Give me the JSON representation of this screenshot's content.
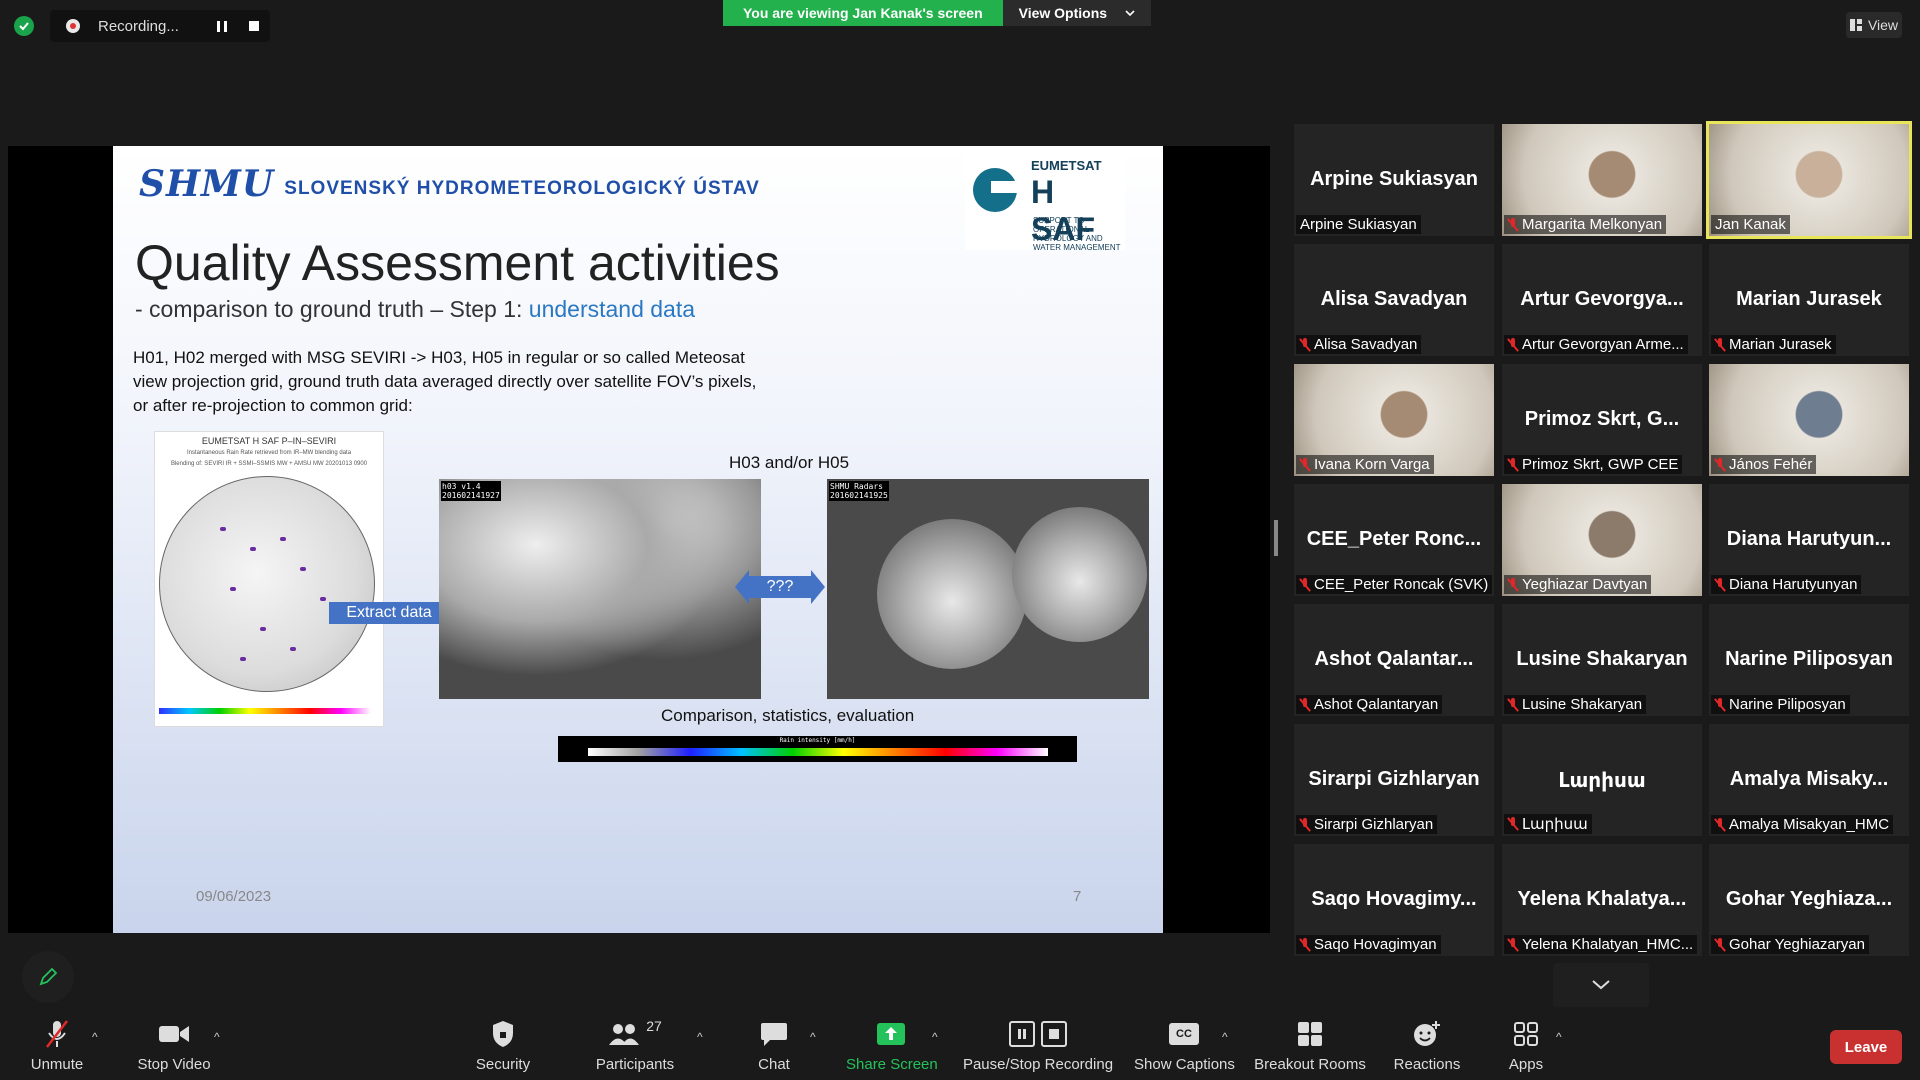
{
  "top": {
    "recording_label": "Recording...",
    "viewing_banner": "You are viewing Jan Kanak's screen",
    "view_options": "View Options",
    "view_label": "View"
  },
  "slide": {
    "shmu_logo": "SHMU",
    "shmu_name": "SLOVENSKÝ HYDROMETEOROLOGICKÝ ÚSTAV",
    "hsaf_org": "EUMETSAT",
    "hsaf_title": "H SAF",
    "hsaf_sub": "SUPPORT TO OPERATIONAL HYDROLOGY AND WATER MANAGEMENT",
    "title": "Quality Assessment activities",
    "subtitle_pre": "- comparison to ground truth – Step 1: ",
    "subtitle_hl": "understand data",
    "body": "H01, H02 merged with MSG SEVIRI -> H03, H05 in regular or so called Meteosat view projection grid, ground truth data averaged directly over satellite FOV’s pixels, or after re-projection to common grid:",
    "map_title": "EUMETSAT H SAF P–IN–SEVIRI",
    "map_sub1": "Instantaneous Rain Rate retrieved from IR–MW blending data",
    "map_sub2": "Blending of: SEVIRI IR + SSMI–SSMIS MW + AMSU MW 20201013 0900",
    "extract": "Extract data",
    "h03_label": "H03 and/or H05",
    "sat1_label_a": "h03 v1.4",
    "sat1_label_b": "201602141927",
    "sat2_label_a": "SHMU Radars",
    "sat2_label_b": "201602141925",
    "qq": "???",
    "comparison": "Comparison, statistics, evaluation",
    "cbar_label": "Rain intensity [mm/h]",
    "date": "09/06/2023",
    "page": "7"
  },
  "participants": [
    {
      "display": "Arpine Sukiasyan",
      "tag": "Arpine Sukiasyan",
      "muted": false,
      "video": false
    },
    {
      "display": "",
      "tag": "Margarita Melkonyan",
      "muted": true,
      "video": true
    },
    {
      "display": "",
      "tag": "Jan Kanak",
      "muted": false,
      "video": true,
      "active": true
    },
    {
      "display": "Alisa Savadyan",
      "tag": "Alisa Savadyan",
      "muted": true,
      "video": false
    },
    {
      "display": "Artur Gevorgya...",
      "tag": "Artur Gevorgyan Arme...",
      "muted": true,
      "video": false
    },
    {
      "display": "Marian Jurasek",
      "tag": "Marian Jurasek",
      "muted": true,
      "video": false
    },
    {
      "display": "",
      "tag": "Ivana Korn Varga",
      "muted": true,
      "video": true
    },
    {
      "display": "Primoz Skrt, G...",
      "tag": "Primoz Skrt, GWP CEE",
      "muted": true,
      "video": false
    },
    {
      "display": "",
      "tag": "János Fehér",
      "muted": true,
      "video": true
    },
    {
      "display": "CEE_Peter Ronc...",
      "tag": "CEE_Peter Roncak (SVK)",
      "muted": true,
      "video": false
    },
    {
      "display": "",
      "tag": "Yeghiazar Davtyan",
      "muted": true,
      "video": true
    },
    {
      "display": "Diana Harutyun...",
      "tag": "Diana Harutyunyan",
      "muted": true,
      "video": false
    },
    {
      "display": "Ashot Qalantar...",
      "tag": "Ashot Qalantaryan",
      "muted": true,
      "video": false
    },
    {
      "display": "Lusine Shakaryan",
      "tag": "Lusine Shakaryan",
      "muted": true,
      "video": false
    },
    {
      "display": "Narine Piliposyan",
      "tag": "Narine Piliposyan",
      "muted": true,
      "video": false
    },
    {
      "display": "Sirarpi Gizhlaryan",
      "tag": "Sirarpi Gizhlaryan",
      "muted": true,
      "video": false
    },
    {
      "display": "Լարիսա",
      "tag": "Լարիսա",
      "muted": true,
      "video": false
    },
    {
      "display": "Amalya Misaky...",
      "tag": "Amalya Misakyan_HMC",
      "muted": true,
      "video": false
    },
    {
      "display": "Saqo Hovagimy...",
      "tag": "Saqo Hovagimyan",
      "muted": true,
      "video": false
    },
    {
      "display": "Yelena Khalatya...",
      "tag": "Yelena Khalatyan_HMC...",
      "muted": true,
      "video": false
    },
    {
      "display": "Gohar Yeghiaza...",
      "tag": "Gohar Yeghiazaryan",
      "muted": true,
      "video": false
    }
  ],
  "toolbar": {
    "unmute": "Unmute",
    "stop_video": "Stop Video",
    "security": "Security",
    "participants": "Participants",
    "participants_count": "27",
    "chat": "Chat",
    "share_screen": "Share Screen",
    "pause_stop": "Pause/Stop Recording",
    "captions": "Show Captions",
    "cc": "CC",
    "breakout": "Breakout Rooms",
    "reactions": "Reactions",
    "apps": "Apps",
    "leave": "Leave"
  },
  "colors": {
    "green_banner": "#23b14d",
    "leave_red": "#c93131",
    "active_speaker": "#e8e55a",
    "slide_accent": "#2b78c2"
  }
}
